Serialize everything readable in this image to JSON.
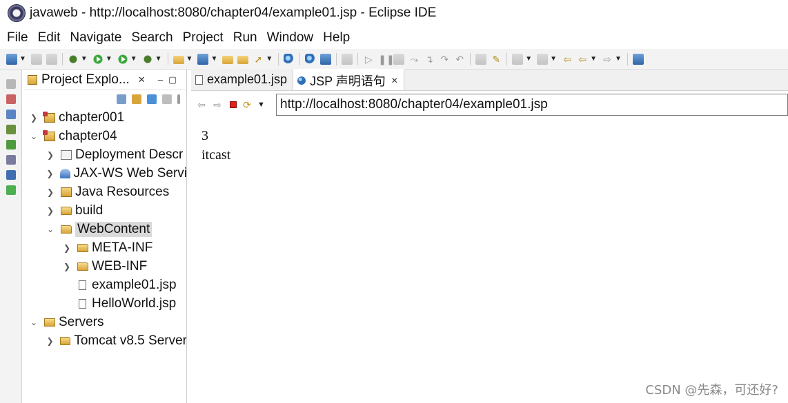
{
  "window": {
    "title": "javaweb - http://localhost:8080/chapter04/example01.jsp - Eclipse IDE"
  },
  "menubar": {
    "items": [
      "File",
      "Edit",
      "Navigate",
      "Search",
      "Project",
      "Run",
      "Window",
      "Help"
    ]
  },
  "explorer": {
    "tab_label": "Project Explo...",
    "tree": [
      {
        "label": "chapter001",
        "icon": "project-icon",
        "twisty": "collapsed",
        "level": 0
      },
      {
        "label": "chapter04",
        "icon": "project-icon",
        "twisty": "expanded",
        "level": 0
      },
      {
        "label": "Deployment Descr",
        "icon": "deployment-descriptor-icon",
        "twisty": "collapsed",
        "level": 1
      },
      {
        "label": "JAX-WS Web Servi",
        "icon": "web-services-icon",
        "twisty": "collapsed",
        "level": 1
      },
      {
        "label": "Java Resources",
        "icon": "java-resources-icon",
        "twisty": "collapsed",
        "level": 1
      },
      {
        "label": "build",
        "icon": "folder-icon",
        "twisty": "collapsed",
        "level": 1
      },
      {
        "label": "WebContent",
        "icon": "folder-icon",
        "twisty": "expanded",
        "level": 1,
        "selected": true
      },
      {
        "label": "META-INF",
        "icon": "folder-icon",
        "twisty": "collapsed",
        "level": 2
      },
      {
        "label": "WEB-INF",
        "icon": "folder-icon",
        "twisty": "collapsed",
        "level": 2
      },
      {
        "label": "example01.jsp",
        "icon": "jsp-file-icon",
        "twisty": "none",
        "level": 2
      },
      {
        "label": "HelloWorld.jsp",
        "icon": "jsp-file-icon",
        "twisty": "none",
        "level": 2
      },
      {
        "label": "Servers",
        "icon": "servers-folder-icon",
        "twisty": "expanded",
        "level": 0
      },
      {
        "label": "Tomcat v8.5 Server",
        "icon": "folder-icon",
        "twisty": "collapsed",
        "level": 1
      }
    ]
  },
  "editor": {
    "tabs": [
      {
        "label": "example01.jsp",
        "active": false
      },
      {
        "label": "JSP 声明语句",
        "active": true
      }
    ],
    "url": "http://localhost:8080/chapter04/example01.jsp",
    "content_lines": [
      "3",
      "itcast"
    ]
  },
  "watermark": "CSDN @先森，可还好?"
}
